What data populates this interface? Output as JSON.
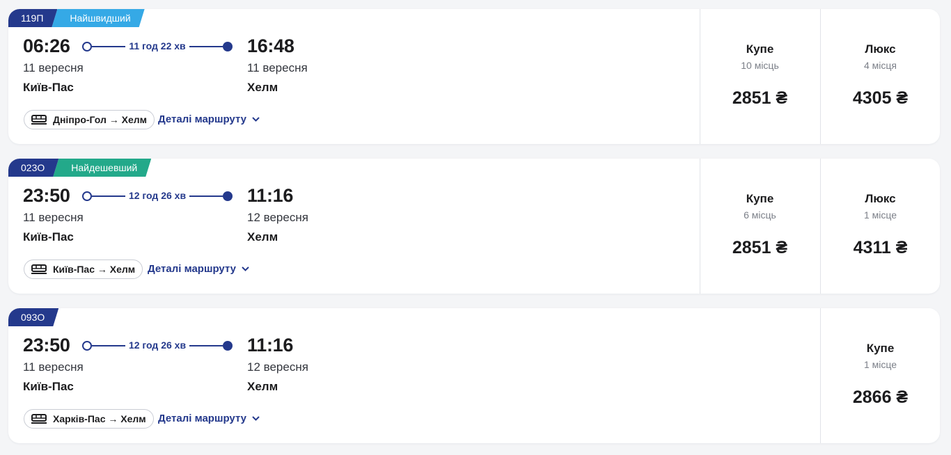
{
  "trains": [
    {
      "number": "119П",
      "tag": "Найшвидший",
      "tag_color": "#35a9e6",
      "departure": {
        "time": "06:26",
        "date": "11 вересня",
        "station": "Київ-Пас"
      },
      "arrival": {
        "time": "16:48",
        "date": "11 вересня",
        "station": "Хелм"
      },
      "duration": "11 год 22 хв",
      "route": "Дніпро-Гол → Хелм",
      "details_label": "Деталі маршруту",
      "classes": [
        {
          "name": "Купе",
          "seats": "10 місць",
          "price": "2851 ₴"
        },
        {
          "name": "Люкс",
          "seats": "4 місця",
          "price": "4305 ₴"
        }
      ]
    },
    {
      "number": "023О",
      "tag": "Найдешевший",
      "tag_color": "#23a98a",
      "departure": {
        "time": "23:50",
        "date": "11 вересня",
        "station": "Київ-Пас"
      },
      "arrival": {
        "time": "11:16",
        "date": "12 вересня",
        "station": "Хелм"
      },
      "duration": "12 год 26 хв",
      "route": "Київ-Пас → Хелм",
      "details_label": "Деталі маршруту",
      "classes": [
        {
          "name": "Купе",
          "seats": "6 місць",
          "price": "2851 ₴"
        },
        {
          "name": "Люкс",
          "seats": "1 місце",
          "price": "4311 ₴"
        }
      ]
    },
    {
      "number": "093О",
      "tag": "",
      "departure": {
        "time": "23:50",
        "date": "11 вересня",
        "station": "Київ-Пас"
      },
      "arrival": {
        "time": "11:16",
        "date": "12 вересня",
        "station": "Хелм"
      },
      "duration": "12 год 26 хв",
      "route": "Харків-Пас → Хелм",
      "details_label": "Деталі маршруту",
      "classes": [
        {
          "name": "Купе",
          "seats": "1 місце",
          "price": "2866 ₴"
        }
      ]
    }
  ],
  "icons": {
    "train": "train-icon",
    "chevron": "chevron-down-icon"
  },
  "colors": {
    "primary": "#24398c",
    "background": "#f4f5f7",
    "card": "#ffffff"
  }
}
